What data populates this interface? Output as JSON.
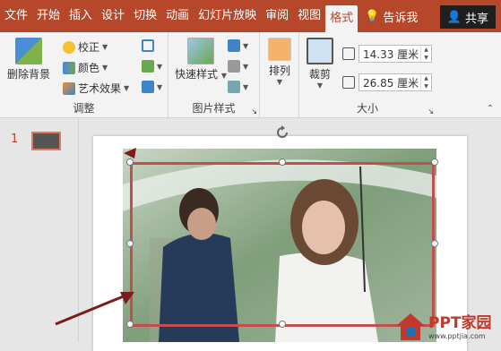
{
  "tabs": [
    "文件",
    "开始",
    "插入",
    "设计",
    "切换",
    "动画",
    "幻灯片放映",
    "审阅",
    "视图",
    "格式"
  ],
  "active_tab": "格式",
  "tell_me": "告诉我",
  "share": "共享",
  "ribbon": {
    "remove_bg": "删除背景",
    "adjust": {
      "corrections": "校正",
      "color": "颜色",
      "artistic": "艺术效果",
      "label": "调整"
    },
    "picture_styles": {
      "quick_styles": "快速样式",
      "label": "图片样式"
    },
    "arrange": {
      "label": "排列"
    },
    "size": {
      "crop": "裁剪",
      "height": "14.33 厘米",
      "width": "26.85 厘米",
      "label": "大小"
    }
  },
  "slide_panel": {
    "number": "1"
  },
  "watermark": {
    "brand": "PPT家园",
    "url": "www.pptjia.com"
  },
  "colors": {
    "accent": "#b7472a",
    "selection": "#c0504d"
  }
}
